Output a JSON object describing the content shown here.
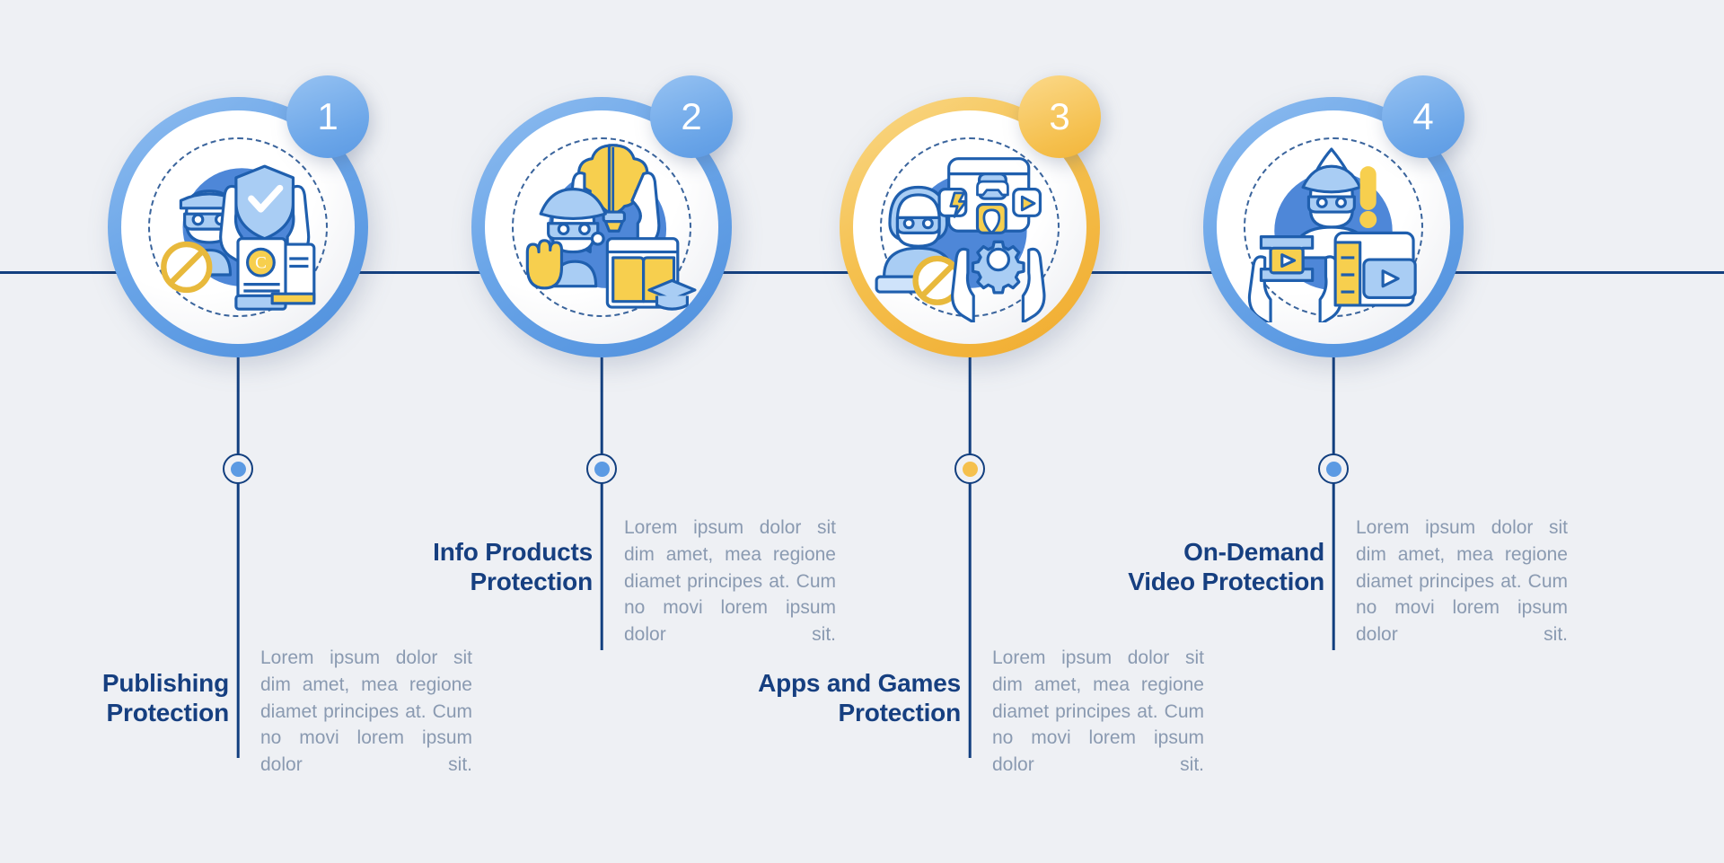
{
  "theme": {
    "background": "#eef0f4",
    "line_color": "#123f7f",
    "title_color": "#163f80",
    "body_color": "#8a9ab1",
    "accent_blue": "#6aa5e8",
    "accent_amber": "#f5c04e",
    "icon_stroke": "#1f5fae",
    "icon_yellow": "#f7cf4e",
    "icon_blue_fill": "#a9cdf4",
    "icon_blue_deep": "#4e87d8"
  },
  "body_text": "Lorem ipsum dolor sit dim amet, mea regione diamet principes at. Cum no movi lorem ipsum dolor sit.",
  "steps": [
    {
      "number": "1",
      "title": "Publishing\nProtection",
      "body": "Lorem ipsum dolor sit dim amet, mea regione diamet principes at. Cum no movi lorem ipsum dolor sit.",
      "color": "blue",
      "icon": "publishing-protection-icon"
    },
    {
      "number": "2",
      "title": "Info Products\nProtection",
      "body": "Lorem ipsum dolor sit dim amet, mea regione diamet principes at. Cum no movi lorem ipsum dolor sit.",
      "color": "blue",
      "icon": "info-products-protection-icon"
    },
    {
      "number": "3",
      "title": "Apps and Games\nProtection",
      "body": "Lorem ipsum dolor sit dim amet, mea regione diamet principes at. Cum no movi lorem ipsum dolor sit.",
      "color": "amber",
      "icon": "apps-games-protection-icon"
    },
    {
      "number": "4",
      "title": "On-Demand\nVideo Protection",
      "body": "Lorem ipsum dolor sit dim amet, mea regione diamet principes at. Cum no movi lorem ipsum dolor sit.",
      "color": "blue",
      "icon": "on-demand-video-protection-icon"
    }
  ]
}
